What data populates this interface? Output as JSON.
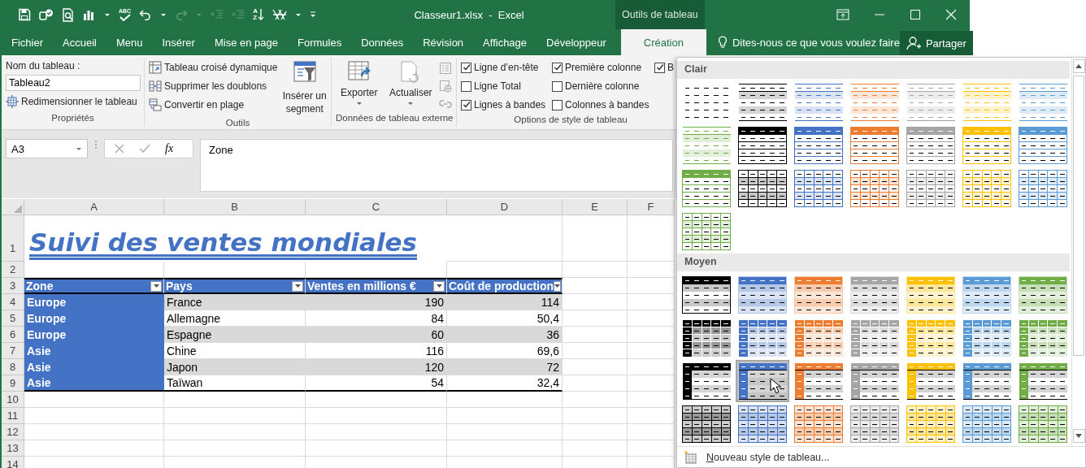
{
  "title_bar": {
    "spell_label": "ABC",
    "sort_labels": [
      "A",
      "Z"
    ],
    "title": "Classeur1.xlsx  -  Excel",
    "contextual_group": "Outils de tableau"
  },
  "tabs": [
    {
      "label": "Fichier",
      "selected": false
    },
    {
      "label": "Accueil",
      "selected": false
    },
    {
      "label": "Menu",
      "selected": false
    },
    {
      "label": "Insérer",
      "selected": false
    },
    {
      "label": "Mise en page",
      "selected": false
    },
    {
      "label": "Formules",
      "selected": false
    },
    {
      "label": "Données",
      "selected": false
    },
    {
      "label": "Révision",
      "selected": false
    },
    {
      "label": "Affichage",
      "selected": false
    },
    {
      "label": "Développeur",
      "selected": false
    },
    {
      "label": "Création",
      "selected": true
    }
  ],
  "tell_me": {
    "placeholder": "Dites-nous ce que vous voulez faire"
  },
  "share_button": "Partager",
  "ribbon": {
    "groups": [
      {
        "kind": "properties",
        "label": "Propriétés",
        "name_label": "Nom du tableau :",
        "name_value": "Tableau2",
        "buttons": [
          "Redimensionner le tableau"
        ]
      },
      {
        "kind": "tools",
        "label": "Outils",
        "buttons": [
          "Tableau croisé dynamique",
          "Supprimer les doublons",
          "Convertir en plage"
        ],
        "large_button": "Insérer un segment"
      },
      {
        "kind": "external",
        "label": "Données de tableau externe",
        "large_buttons": [
          "Exporter",
          "Actualiser"
        ]
      },
      {
        "kind": "options",
        "label": "Options de style de tableau",
        "checkboxes": [
          {
            "kind": "header-row",
            "label": "Ligne d’en-tête",
            "checked": true
          },
          {
            "kind": "total-row",
            "label": "Ligne Total",
            "checked": false
          },
          {
            "kind": "banded-rows",
            "label": "Lignes à bandes",
            "checked": true
          },
          {
            "kind": "first-column",
            "label": "Première colonne",
            "checked": true
          },
          {
            "kind": "last-column",
            "label": "Dernière colonne",
            "checked": false
          },
          {
            "kind": "banded-columns",
            "label": "Colonnes à bandes",
            "checked": false
          },
          {
            "kind": "filter-button",
            "label": "B",
            "checked": true
          }
        ]
      }
    ]
  },
  "formula_bar": {
    "name_box": "A3",
    "function_label": "fx",
    "formula": "Zone"
  },
  "sheet": {
    "column_headers": [
      "A",
      "B",
      "C",
      "D",
      "E",
      "F"
    ],
    "row_headers": [
      "1",
      "2",
      "3",
      "4",
      "5",
      "6",
      "7",
      "8",
      "9",
      "10",
      "11",
      "12",
      "13",
      "14"
    ],
    "title": "Suivi des ventes mondiales",
    "table": {
      "columns": [
        "Zone",
        "Pays",
        "Ventes en millions €",
        "Coût de production"
      ],
      "rows": [
        [
          "Europe",
          "France",
          "190",
          "114"
        ],
        [
          "Europe",
          "Allemagne",
          "84",
          "50,4"
        ],
        [
          "Europe",
          "Espagne",
          "60",
          "36"
        ],
        [
          "Asie",
          "Chine",
          "116",
          "69,6"
        ],
        [
          "Asie",
          "Japon",
          "120",
          "72"
        ],
        [
          "Asie",
          "Taïwan",
          "54",
          "32,4"
        ]
      ]
    }
  },
  "style_gallery": {
    "sections": [
      {
        "title": "Clair",
        "styles": [
          {
            "kind": "plain",
            "color": "#000000",
            "selected": false
          },
          {
            "kind": "light-lines",
            "color": "#000000",
            "selected": false
          },
          {
            "kind": "light-lines",
            "color": "#4472c4",
            "selected": false
          },
          {
            "kind": "light-lines",
            "color": "#ed7d31",
            "selected": false
          },
          {
            "kind": "light-lines",
            "color": "#a5a5a5",
            "selected": false
          },
          {
            "kind": "light-lines",
            "color": "#ffc000",
            "selected": false
          },
          {
            "kind": "light-lines",
            "color": "#5b9bd5",
            "selected": false
          },
          {
            "kind": "light-lines",
            "color": "#70ad47",
            "selected": false
          },
          {
            "kind": "header-rows",
            "color": "#000000",
            "selected": false
          },
          {
            "kind": "header-rows",
            "color": "#4472c4",
            "selected": false
          },
          {
            "kind": "header-rows",
            "color": "#ed7d31",
            "selected": false
          },
          {
            "kind": "header-rows",
            "color": "#a5a5a5",
            "selected": false
          },
          {
            "kind": "header-rows",
            "color": "#ffc000",
            "selected": false
          },
          {
            "kind": "header-rows",
            "color": "#5b9bd5",
            "selected": false
          },
          {
            "kind": "header-rows",
            "color": "#70ad47",
            "selected": false
          },
          {
            "kind": "grid",
            "color": "#000000",
            "selected": false
          },
          {
            "kind": "grid",
            "color": "#4472c4",
            "selected": false
          },
          {
            "kind": "grid",
            "color": "#ed7d31",
            "selected": false
          },
          {
            "kind": "grid",
            "color": "#a5a5a5",
            "selected": false
          },
          {
            "kind": "grid",
            "color": "#ffc000",
            "selected": false
          },
          {
            "kind": "grid",
            "color": "#5b9bd5",
            "selected": false
          },
          {
            "kind": "grid",
            "color": "#70ad47",
            "selected": false
          }
        ]
      },
      {
        "title": "Moyen",
        "styles": [
          {
            "kind": "header-banded",
            "color": "#000000",
            "selected": false
          },
          {
            "kind": "header-banded",
            "color": "#4472c4",
            "selected": false
          },
          {
            "kind": "header-banded",
            "color": "#ed7d31",
            "selected": false
          },
          {
            "kind": "header-banded",
            "color": "#a5a5a5",
            "selected": false
          },
          {
            "kind": "header-banded",
            "color": "#ffc000",
            "selected": false
          },
          {
            "kind": "header-banded",
            "color": "#5b9bd5",
            "selected": false
          },
          {
            "kind": "header-banded",
            "color": "#70ad47",
            "selected": false
          },
          {
            "kind": "first-col-grid",
            "color": "#000000",
            "selected": false
          },
          {
            "kind": "first-col-grid",
            "color": "#4472c4",
            "selected": false
          },
          {
            "kind": "first-col-grid",
            "color": "#ed7d31",
            "selected": false
          },
          {
            "kind": "first-col-grid",
            "color": "#a5a5a5",
            "selected": false
          },
          {
            "kind": "first-col-grid",
            "color": "#ffc000",
            "selected": false
          },
          {
            "kind": "first-col-grid",
            "color": "#5b9bd5",
            "selected": false
          },
          {
            "kind": "first-col-grid",
            "color": "#70ad47",
            "selected": false
          },
          {
            "kind": "first-col-header",
            "color": "#000000",
            "selected": false
          },
          {
            "kind": "first-col-header",
            "color": "#4472c4",
            "selected": true
          },
          {
            "kind": "first-col-header",
            "color": "#ed7d31",
            "selected": false
          },
          {
            "kind": "first-col-header",
            "color": "#a5a5a5",
            "selected": false
          },
          {
            "kind": "first-col-header",
            "color": "#ffc000",
            "selected": false
          },
          {
            "kind": "first-col-header",
            "color": "#5b9bd5",
            "selected": false
          },
          {
            "kind": "first-col-header",
            "color": "#70ad47",
            "selected": false
          },
          {
            "kind": "banded-grid",
            "color": "#000000",
            "selected": false
          },
          {
            "kind": "banded-grid",
            "color": "#4472c4",
            "selected": false
          },
          {
            "kind": "banded-grid",
            "color": "#ed7d31",
            "selected": false
          },
          {
            "kind": "banded-grid",
            "color": "#a5a5a5",
            "selected": false
          },
          {
            "kind": "banded-grid",
            "color": "#ffc000",
            "selected": false
          },
          {
            "kind": "banded-grid",
            "color": "#5b9bd5",
            "selected": false
          },
          {
            "kind": "banded-grid",
            "color": "#70ad47",
            "selected": false
          }
        ]
      }
    ],
    "footer": "Nouveau style de tableau..."
  }
}
